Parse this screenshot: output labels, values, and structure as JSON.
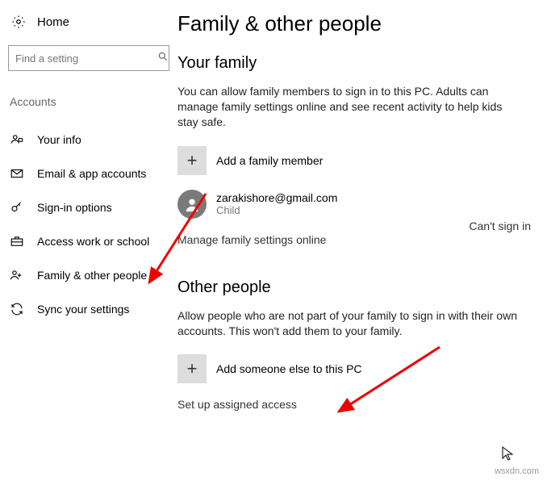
{
  "home_label": "Home",
  "search_placeholder": "Find a setting",
  "category_label": "Accounts",
  "nav": [
    {
      "label": "Your info"
    },
    {
      "label": "Email & app accounts"
    },
    {
      "label": "Sign-in options"
    },
    {
      "label": "Access work or school"
    },
    {
      "label": "Family & other people"
    },
    {
      "label": "Sync your settings"
    }
  ],
  "page_title": "Family & other people",
  "family": {
    "heading": "Your family",
    "desc": "You can allow family members to sign in to this PC. Adults can manage family settings online and see recent activity to help kids stay safe.",
    "add_label": "Add a family member",
    "user_email": "zarakishore@gmail.com",
    "user_role": "Child",
    "user_status": "Can't sign in",
    "manage_link": "Manage family settings online"
  },
  "other": {
    "heading": "Other people",
    "desc": "Allow people who are not part of your family to sign in with their own accounts. This won't add them to your family.",
    "add_label": "Add someone else to this PC",
    "assigned_link": "Set up assigned access"
  },
  "watermark": "wsxdn.com"
}
